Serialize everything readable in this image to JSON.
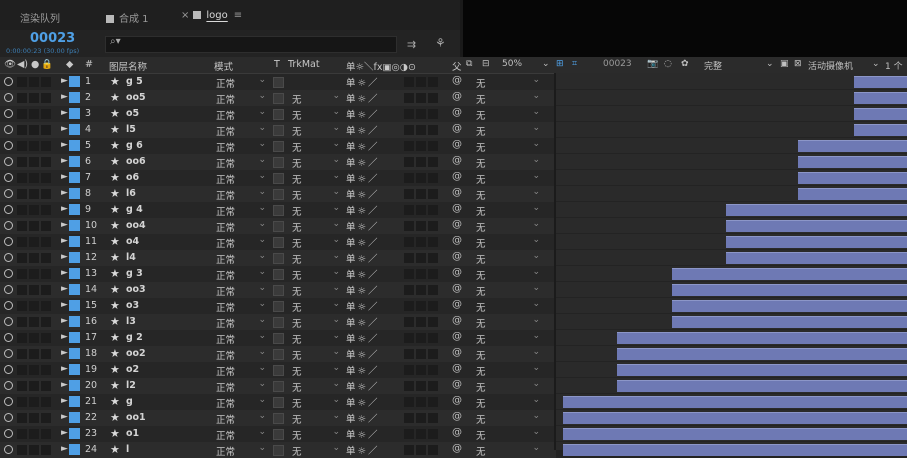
{
  "tabs": [
    {
      "label": "渲染队列",
      "active": false,
      "has_swatch": false,
      "has_close": false
    },
    {
      "label": "合成 1",
      "active": false,
      "has_swatch": true,
      "has_close": false
    },
    {
      "label": "logo",
      "active": true,
      "has_swatch": true,
      "has_close": true
    }
  ],
  "tab_menu_icon": "hamburger-icon",
  "time": {
    "frame": "00023",
    "timecode": "0:00:00:23 (30.00 fps)"
  },
  "search": {
    "placeholder": ""
  },
  "header": {
    "num": "#",
    "layer_name": "图层名称",
    "mode": "模式",
    "t": "T",
    "trkmat": "TrkMat",
    "parent_short": "父"
  },
  "viewer_toolbar": {
    "zoom": "50%",
    "frame": "00023",
    "resolution": "完整",
    "camera": "活动摄像机",
    "views": "1 个"
  },
  "colors": {
    "accent": "#4fa0e6",
    "label": "#4f9fe5",
    "bar": "#6e79b4"
  },
  "layers": [
    {
      "num": "1",
      "name": "g 5",
      "mode": "正常",
      "trkmat": "",
      "parent": "无",
      "bar_start_fraction": 0.85
    },
    {
      "num": "2",
      "name": "oo5",
      "mode": "正常",
      "trkmat": "无",
      "parent": "无",
      "bar_start_fraction": 0.85
    },
    {
      "num": "3",
      "name": "o5",
      "mode": "正常",
      "trkmat": "无",
      "parent": "无",
      "bar_start_fraction": 0.85
    },
    {
      "num": "4",
      "name": "l5",
      "mode": "正常",
      "trkmat": "无",
      "parent": "无",
      "bar_start_fraction": 0.85
    },
    {
      "num": "5",
      "name": "g 6",
      "mode": "正常",
      "trkmat": "无",
      "parent": "无",
      "bar_start_fraction": 0.69
    },
    {
      "num": "6",
      "name": "oo6",
      "mode": "正常",
      "trkmat": "无",
      "parent": "无",
      "bar_start_fraction": 0.69
    },
    {
      "num": "7",
      "name": "o6",
      "mode": "正常",
      "trkmat": "无",
      "parent": "无",
      "bar_start_fraction": 0.69
    },
    {
      "num": "8",
      "name": "l6",
      "mode": "正常",
      "trkmat": "无",
      "parent": "无",
      "bar_start_fraction": 0.69
    },
    {
      "num": "9",
      "name": "g 4",
      "mode": "正常",
      "trkmat": "无",
      "parent": "无",
      "bar_start_fraction": 0.485
    },
    {
      "num": "10",
      "name": "oo4",
      "mode": "正常",
      "trkmat": "无",
      "parent": "无",
      "bar_start_fraction": 0.485
    },
    {
      "num": "11",
      "name": "o4",
      "mode": "正常",
      "trkmat": "无",
      "parent": "无",
      "bar_start_fraction": 0.485
    },
    {
      "num": "12",
      "name": "l4",
      "mode": "正常",
      "trkmat": "无",
      "parent": "无",
      "bar_start_fraction": 0.485
    },
    {
      "num": "13",
      "name": "g 3",
      "mode": "正常",
      "trkmat": "无",
      "parent": "无",
      "bar_start_fraction": 0.33
    },
    {
      "num": "14",
      "name": "oo3",
      "mode": "正常",
      "trkmat": "无",
      "parent": "无",
      "bar_start_fraction": 0.33
    },
    {
      "num": "15",
      "name": "o3",
      "mode": "正常",
      "trkmat": "无",
      "parent": "无",
      "bar_start_fraction": 0.33
    },
    {
      "num": "16",
      "name": "l3",
      "mode": "正常",
      "trkmat": "无",
      "parent": "无",
      "bar_start_fraction": 0.33
    },
    {
      "num": "17",
      "name": "g 2",
      "mode": "正常",
      "trkmat": "无",
      "parent": "无",
      "bar_start_fraction": 0.175
    },
    {
      "num": "18",
      "name": "oo2",
      "mode": "正常",
      "trkmat": "无",
      "parent": "无",
      "bar_start_fraction": 0.175
    },
    {
      "num": "19",
      "name": "o2",
      "mode": "正常",
      "trkmat": "无",
      "parent": "无",
      "bar_start_fraction": 0.175
    },
    {
      "num": "20",
      "name": "l2",
      "mode": "正常",
      "trkmat": "无",
      "parent": "无",
      "bar_start_fraction": 0.175
    },
    {
      "num": "21",
      "name": "g",
      "mode": "正常",
      "trkmat": "无",
      "parent": "无",
      "bar_start_fraction": 0.02
    },
    {
      "num": "22",
      "name": "oo1",
      "mode": "正常",
      "trkmat": "无",
      "parent": "无",
      "bar_start_fraction": 0.02
    },
    {
      "num": "23",
      "name": "o1",
      "mode": "正常",
      "trkmat": "无",
      "parent": "无",
      "bar_start_fraction": 0.02
    },
    {
      "num": "24",
      "name": "l",
      "mode": "正常",
      "trkmat": "无",
      "parent": "无",
      "bar_start_fraction": 0.02
    }
  ]
}
